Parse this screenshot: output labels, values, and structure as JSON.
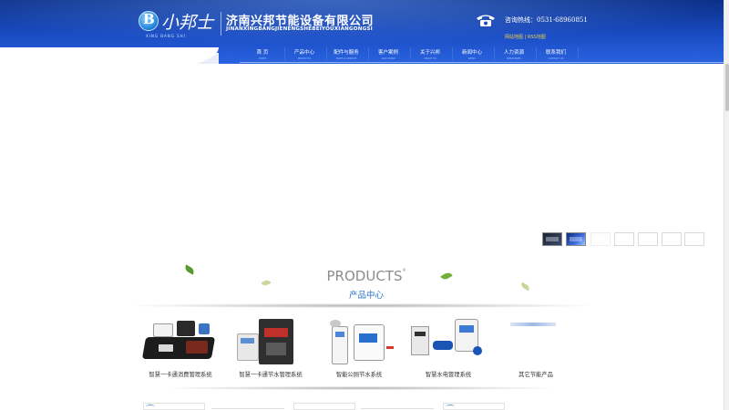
{
  "header": {
    "logo_text": "小邦士",
    "logo_sub": "XING BANG SHI",
    "company_name_cn": "济南兴邦节能设备有限公司",
    "company_name_en": "JINANXINGBANGJIENENGSHEBEIYOUXIANGONGSI",
    "hotline_label": "咨询热线：",
    "hotline_number": "0531-68960851",
    "links": [
      "网站地图",
      "RSS地图"
    ],
    "link_separator": "|",
    "colors": {
      "header_dark": "#0b2f86",
      "header_light": "#2a63e0",
      "link_yellow": "#e8d24b"
    }
  },
  "nav": {
    "items": [
      {
        "label": "首 页",
        "sub": "HOME"
      },
      {
        "label": "产品中心",
        "sub": "PRODUCTS"
      },
      {
        "label": "配件与服务",
        "sub": "PARTS & SERVICE"
      },
      {
        "label": "客户案例",
        "sub": "SOLUTIONS"
      },
      {
        "label": "关于兴邦",
        "sub": "ABOUT US"
      },
      {
        "label": "新闻中心",
        "sub": "NEWS"
      },
      {
        "label": "人力资源",
        "sub": "RESOURCES"
      },
      {
        "label": "联系我们",
        "sub": "CONTACT US"
      }
    ]
  },
  "banner": {
    "thumbnail_count": 7,
    "active_thumbnail": 1,
    "thumb3_text": "........................"
  },
  "products_section": {
    "title_en": "PRODUCTS",
    "title_en_mark": "®",
    "title_cn": "产品中心",
    "items": [
      {
        "label": "智慧一卡通消费管理系统",
        "icon": "card-terminal-product-image"
      },
      {
        "label": "智慧一卡通节水管理系统",
        "icon": "water-controller-product-image"
      },
      {
        "label": "智能公厕节水系统",
        "icon": "toilet-water-saver-product-image"
      },
      {
        "label": "智慧水电管理系统",
        "icon": "water-electric-meter-product-image"
      },
      {
        "label": "其它节能产品",
        "icon": "other-products-image"
      }
    ]
  }
}
